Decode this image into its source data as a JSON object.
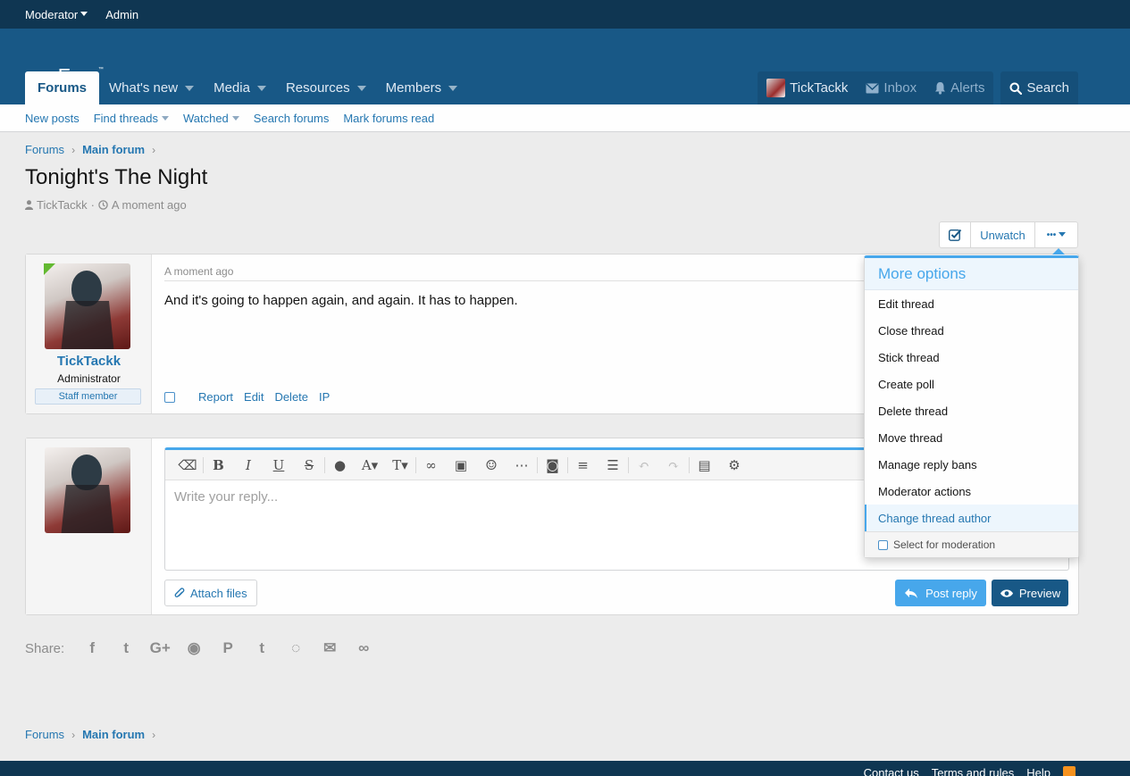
{
  "staffbar": {
    "moderator": "Moderator",
    "admin": "Admin"
  },
  "header": {
    "logo": "xenForo",
    "logo_tm": "™",
    "tabs": [
      {
        "label": "Forums"
      },
      {
        "label": "What's new"
      },
      {
        "label": "Media"
      },
      {
        "label": "Resources"
      },
      {
        "label": "Members"
      }
    ],
    "account": "TickTackk",
    "inbox": "Inbox",
    "alerts": "Alerts",
    "search": "Search"
  },
  "subnav": {
    "new_posts": "New posts",
    "find_threads": "Find threads",
    "watched": "Watched",
    "search_forums": "Search forums",
    "mark_read": "Mark forums read"
  },
  "breadcrumb": {
    "forums": "Forums",
    "main_forum": "Main forum"
  },
  "thread": {
    "title": "Tonight's The Night",
    "author": "TickTackk",
    "time": "A moment ago",
    "separator": "·"
  },
  "thread_buttons": {
    "unwatch": "Unwatch",
    "more": "•••"
  },
  "post": {
    "username": "TickTackk",
    "user_title": "Administrator",
    "staff_badge": "Staff member",
    "date": "A moment ago",
    "body": "And it's going to happen again, and again. It has to happen.",
    "actions": {
      "report": "Report",
      "edit": "Edit",
      "delete": "Delete",
      "ip": "IP"
    }
  },
  "reply": {
    "placeholder": "Write your reply...",
    "attach": "Attach files",
    "post_reply": "Post reply",
    "preview": "Preview"
  },
  "share": {
    "label": "Share:"
  },
  "menu": {
    "title": "More options",
    "items": [
      "Edit thread",
      "Close thread",
      "Stick thread",
      "Create poll",
      "Delete thread",
      "Move thread",
      "Manage reply bans",
      "Moderator actions",
      "Change thread author"
    ],
    "select_moderation": "Select for moderation"
  },
  "footer": {
    "contact": "Contact us",
    "terms": "Terms and rules",
    "help": "Help"
  },
  "colors": {
    "header_bg": "#185886",
    "staffbar_bg": "#0f3652",
    "accent": "#47a7eb",
    "link": "#2577b1"
  }
}
